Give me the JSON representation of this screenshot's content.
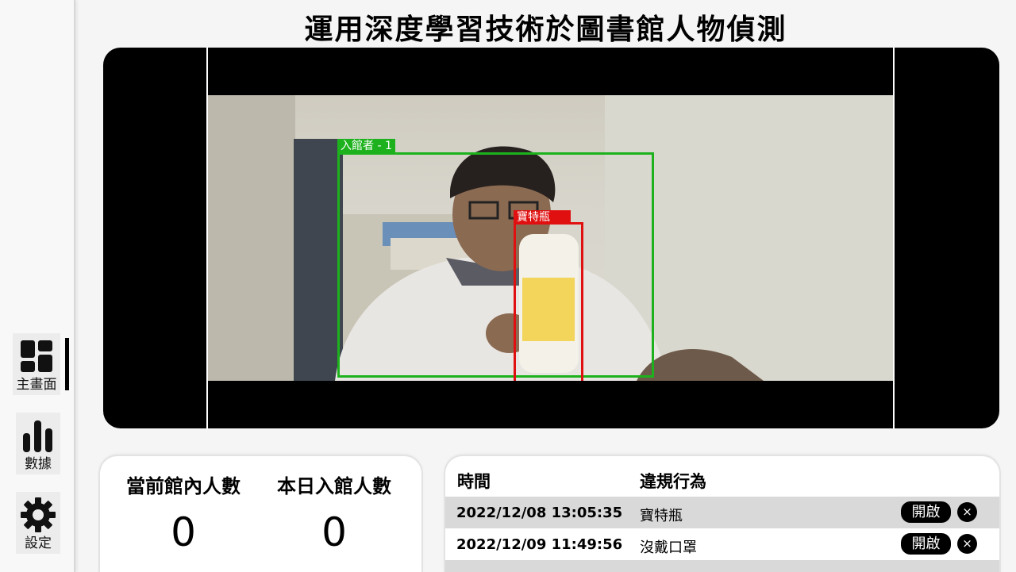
{
  "title": "運用深度學習技術於圖書館人物偵測",
  "sidebar": {
    "items": [
      {
        "label": "主畫面",
        "icon": "dashboard-icon"
      },
      {
        "label": "數據",
        "icon": "bar-chart-icon"
      },
      {
        "label": "設定",
        "icon": "gear-icon"
      }
    ]
  },
  "video": {
    "detections": [
      {
        "label": "入館者 - 1",
        "color": "#1db21d"
      },
      {
        "label": "寶特瓶",
        "color": "#e01010"
      }
    ]
  },
  "stats": {
    "current_label": "當前館內人數",
    "current_value": "0",
    "today_label": "本日入館人數",
    "today_value": "0"
  },
  "violations": {
    "headers": {
      "time": "時間",
      "violation": "違規行為"
    },
    "open_label": "開啟",
    "close_label": "×",
    "rows": [
      {
        "time": "2022/12/08 13:05:35",
        "violation": "寶特瓶"
      },
      {
        "time": "2022/12/09 11:49:56",
        "violation": "沒戴口罩"
      }
    ]
  }
}
